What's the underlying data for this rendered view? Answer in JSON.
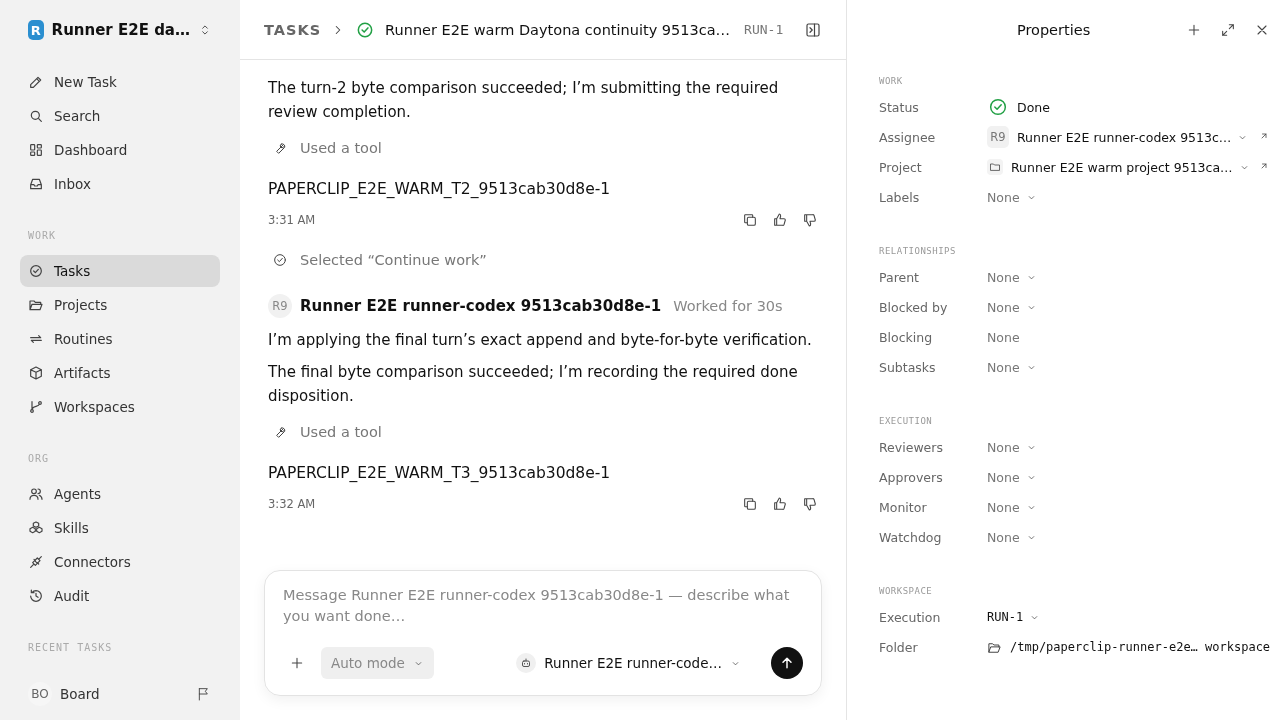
{
  "sidebar": {
    "workspace": {
      "badge": "R",
      "name": "Runner E2E da…"
    },
    "top_items": [
      {
        "label": "New Task",
        "selected": false
      },
      {
        "label": "Search",
        "selected": false
      },
      {
        "label": "Dashboard",
        "selected": false
      },
      {
        "label": "Inbox",
        "selected": false
      }
    ],
    "sections": [
      {
        "title": "WORK",
        "items": [
          {
            "label": "Tasks",
            "selected": true
          },
          {
            "label": "Projects",
            "selected": false
          },
          {
            "label": "Routines",
            "selected": false
          },
          {
            "label": "Artifacts",
            "selected": false
          },
          {
            "label": "Workspaces",
            "selected": false
          }
        ]
      },
      {
        "title": "ORG",
        "items": [
          {
            "label": "Agents",
            "selected": false
          },
          {
            "label": "Skills",
            "selected": false
          },
          {
            "label": "Connectors",
            "selected": false
          },
          {
            "label": "Audit",
            "selected": false
          }
        ]
      },
      {
        "title": "RECENT TASKS"
      }
    ],
    "user": {
      "initials": "BO",
      "name": "Board"
    }
  },
  "header": {
    "breadcrumb": "TASKS",
    "title": "Runner E2E warm Daytona continuity 9513ca…",
    "run": "RUN-1"
  },
  "messages": [
    {
      "kind": "text",
      "text": "The turn-2 byte comparison succeeded; I’m submitting the required review completion."
    },
    {
      "kind": "tool",
      "text": "Used a tool"
    },
    {
      "kind": "code",
      "text": "PAPERCLIP_E2E_WARM_T2_9513cab30d8e-1"
    },
    {
      "kind": "meta",
      "text": "3:31 AM"
    },
    {
      "kind": "choice",
      "text": "Selected “Continue work”"
    },
    {
      "kind": "author",
      "avatar": "R9",
      "name": "Runner E2E runner-codex 9513cab30d8e-1",
      "note": "Worked for 30s"
    },
    {
      "kind": "text",
      "text": "I’m applying the final turn’s exact append and byte-for-byte verification."
    },
    {
      "kind": "text",
      "text": "The final byte comparison succeeded; I’m recording the required done disposition."
    },
    {
      "kind": "tool",
      "text": "Used a tool"
    },
    {
      "kind": "code",
      "text": "PAPERCLIP_E2E_WARM_T3_9513cab30d8e-1"
    },
    {
      "kind": "meta",
      "text": "3:32 AM"
    }
  ],
  "composer": {
    "placeholder": "Message Runner E2E runner-codex 9513cab30d8e-1 — describe what you want done…",
    "mode": "Auto mode",
    "agent": "Runner E2E runner-code…"
  },
  "properties": {
    "title": "Properties",
    "sections": [
      {
        "title": "WORK",
        "rows": [
          {
            "label": "Status",
            "kind": "status",
            "value": "Done"
          },
          {
            "label": "Assignee",
            "kind": "avatar",
            "avatar": "R9",
            "value": "Runner E2E runner-codex 9513c…"
          },
          {
            "label": "Project",
            "kind": "project",
            "value": "Runner E2E warm project 9513ca…"
          },
          {
            "label": "Labels",
            "kind": "none",
            "value": "None"
          }
        ]
      },
      {
        "title": "RELATIONSHIPS",
        "rows": [
          {
            "label": "Parent",
            "kind": "none",
            "value": "None"
          },
          {
            "label": "Blocked by",
            "kind": "none",
            "value": "None"
          },
          {
            "label": "Blocking",
            "kind": "plain",
            "value": "None"
          },
          {
            "label": "Subtasks",
            "kind": "none",
            "value": "None"
          }
        ]
      },
      {
        "title": "EXECUTION",
        "rows": [
          {
            "label": "Reviewers",
            "kind": "none",
            "value": "None"
          },
          {
            "label": "Approvers",
            "kind": "none",
            "value": "None"
          },
          {
            "label": "Monitor",
            "kind": "none",
            "value": "None"
          },
          {
            "label": "Watchdog",
            "kind": "none",
            "value": "None"
          }
        ]
      },
      {
        "title": "WORKSPACE",
        "rows": [
          {
            "label": "Execution",
            "kind": "run",
            "value": "RUN-1"
          },
          {
            "label": "Folder",
            "kind": "folder",
            "value": "/tmp/paperclip-runner-e2e… workspace"
          }
        ]
      }
    ]
  }
}
